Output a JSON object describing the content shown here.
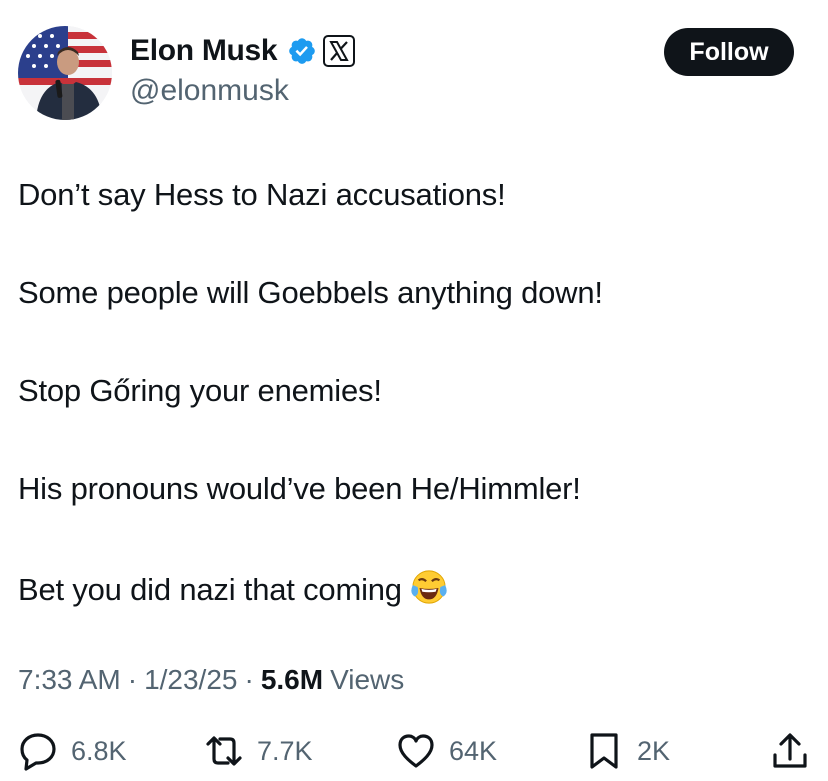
{
  "author": {
    "name": "Elon Musk",
    "handle": "@elonmusk",
    "verified": true,
    "affiliation_badge": "x-logo-icon"
  },
  "follow_button": {
    "label": "Follow"
  },
  "tweet": {
    "lines": [
      "Don’t say Hess to Nazi accusations!",
      "Some people will Goebbels anything down!",
      "Stop Gőring your enemies!",
      "His pronouns would’ve been He/Himmler!",
      "Bet you did nazi that coming"
    ],
    "emoji": "face-with-tears-of-joy-emoji"
  },
  "meta": {
    "time": "7:33 AM",
    "date": "1/23/25",
    "views_count": "5.6M",
    "views_label": "Views"
  },
  "actions": {
    "replies": "6.8K",
    "reposts": "7.7K",
    "likes": "64K",
    "bookmarks": "2K"
  },
  "colors": {
    "text": "#0f1419",
    "secondary": "#536471",
    "verified": "#1d9bf0",
    "follow_bg": "#0f1419"
  }
}
